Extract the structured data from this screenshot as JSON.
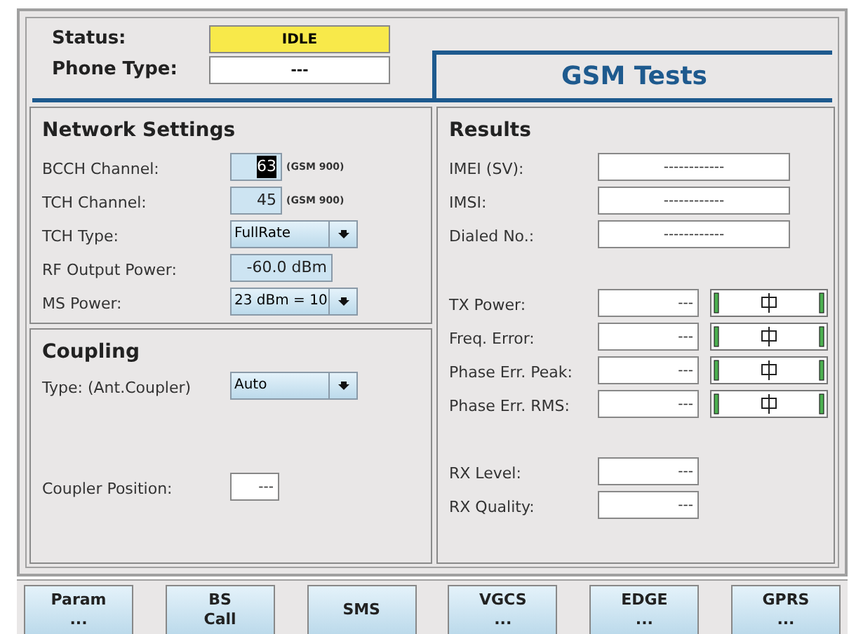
{
  "status": {
    "label": "Status:",
    "value": "IDLE"
  },
  "phone_type": {
    "label": "Phone Type:",
    "value": "---"
  },
  "title": "GSM Tests",
  "network_settings": {
    "title": "Network Settings",
    "rows": [
      {
        "kind": "number",
        "label": "BCCH Channel:",
        "value": "63",
        "unit": "(GSM 900)",
        "highlighted": true
      },
      {
        "kind": "number",
        "label": "TCH Channel:",
        "value": "45",
        "unit": "(GSM 900)",
        "highlighted": false
      },
      {
        "kind": "select",
        "label": "TCH Type:",
        "value": "FullRate"
      },
      {
        "kind": "number",
        "label": "RF Output Power:",
        "value": "-60.0 dBm",
        "highlighted": false
      },
      {
        "kind": "select",
        "label": "MS Power:",
        "value": "23 dBm = 10"
      }
    ]
  },
  "coupling": {
    "title": "Coupling",
    "type": {
      "label": "Type: (Ant.Coupler)",
      "value": "Auto"
    },
    "position": {
      "label": "Coupler Position:",
      "value": "---"
    }
  },
  "results": {
    "title": "Results",
    "info": [
      {
        "label": "IMEI (SV):",
        "value": "------------"
      },
      {
        "label": "IMSI:",
        "value": "------------"
      },
      {
        "label": "Dialed No.:",
        "value": "------------"
      }
    ],
    "measurements": [
      {
        "label": "TX Power:",
        "value": "---"
      },
      {
        "label": "Freq. Error:",
        "value": "---"
      },
      {
        "label": "Phase Err. Peak:",
        "value": "---"
      },
      {
        "label": "Phase Err. RMS:",
        "value": "---"
      }
    ],
    "rx": [
      {
        "label": "RX Level:",
        "value": "---"
      },
      {
        "label": "RX Quality:",
        "value": "---"
      }
    ]
  },
  "buttons": [
    {
      "label": "Param",
      "sub": "..."
    },
    {
      "label": "BS",
      "sub": "Call"
    },
    {
      "label": "SMS"
    },
    {
      "label": "VGCS",
      "sub": "..."
    },
    {
      "label": "EDGE",
      "sub": "..."
    },
    {
      "label": "GPRS",
      "sub": "..."
    }
  ]
}
